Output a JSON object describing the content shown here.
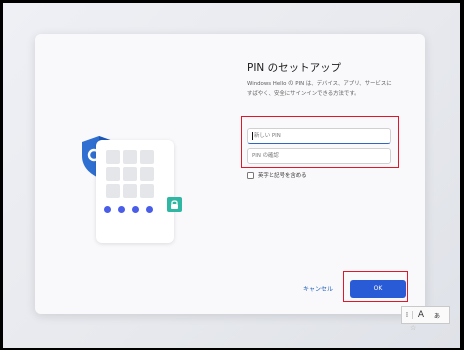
{
  "dialog": {
    "title": "PIN のセットアップ",
    "description": "Windows Hello の PIN は、デバイス、アプリ、サービスにすばやく、安全にサインインできる方法です。",
    "new_pin_placeholder": "新しい PIN",
    "confirm_pin_placeholder": "PIN の確認",
    "include_letters_label": "英字と記号を含める",
    "include_letters_checked": false,
    "cancel_label": "キャンセル",
    "ok_label": "OK"
  },
  "ime_bar": {
    "mode_indicator": "A",
    "extra_label": "あ",
    "settings_label": "☆"
  },
  "colors": {
    "accent": "#2a5bd7",
    "highlight_box": "#e0172a",
    "shield": "#2f6fd1",
    "lock": "#2fb7a3"
  }
}
